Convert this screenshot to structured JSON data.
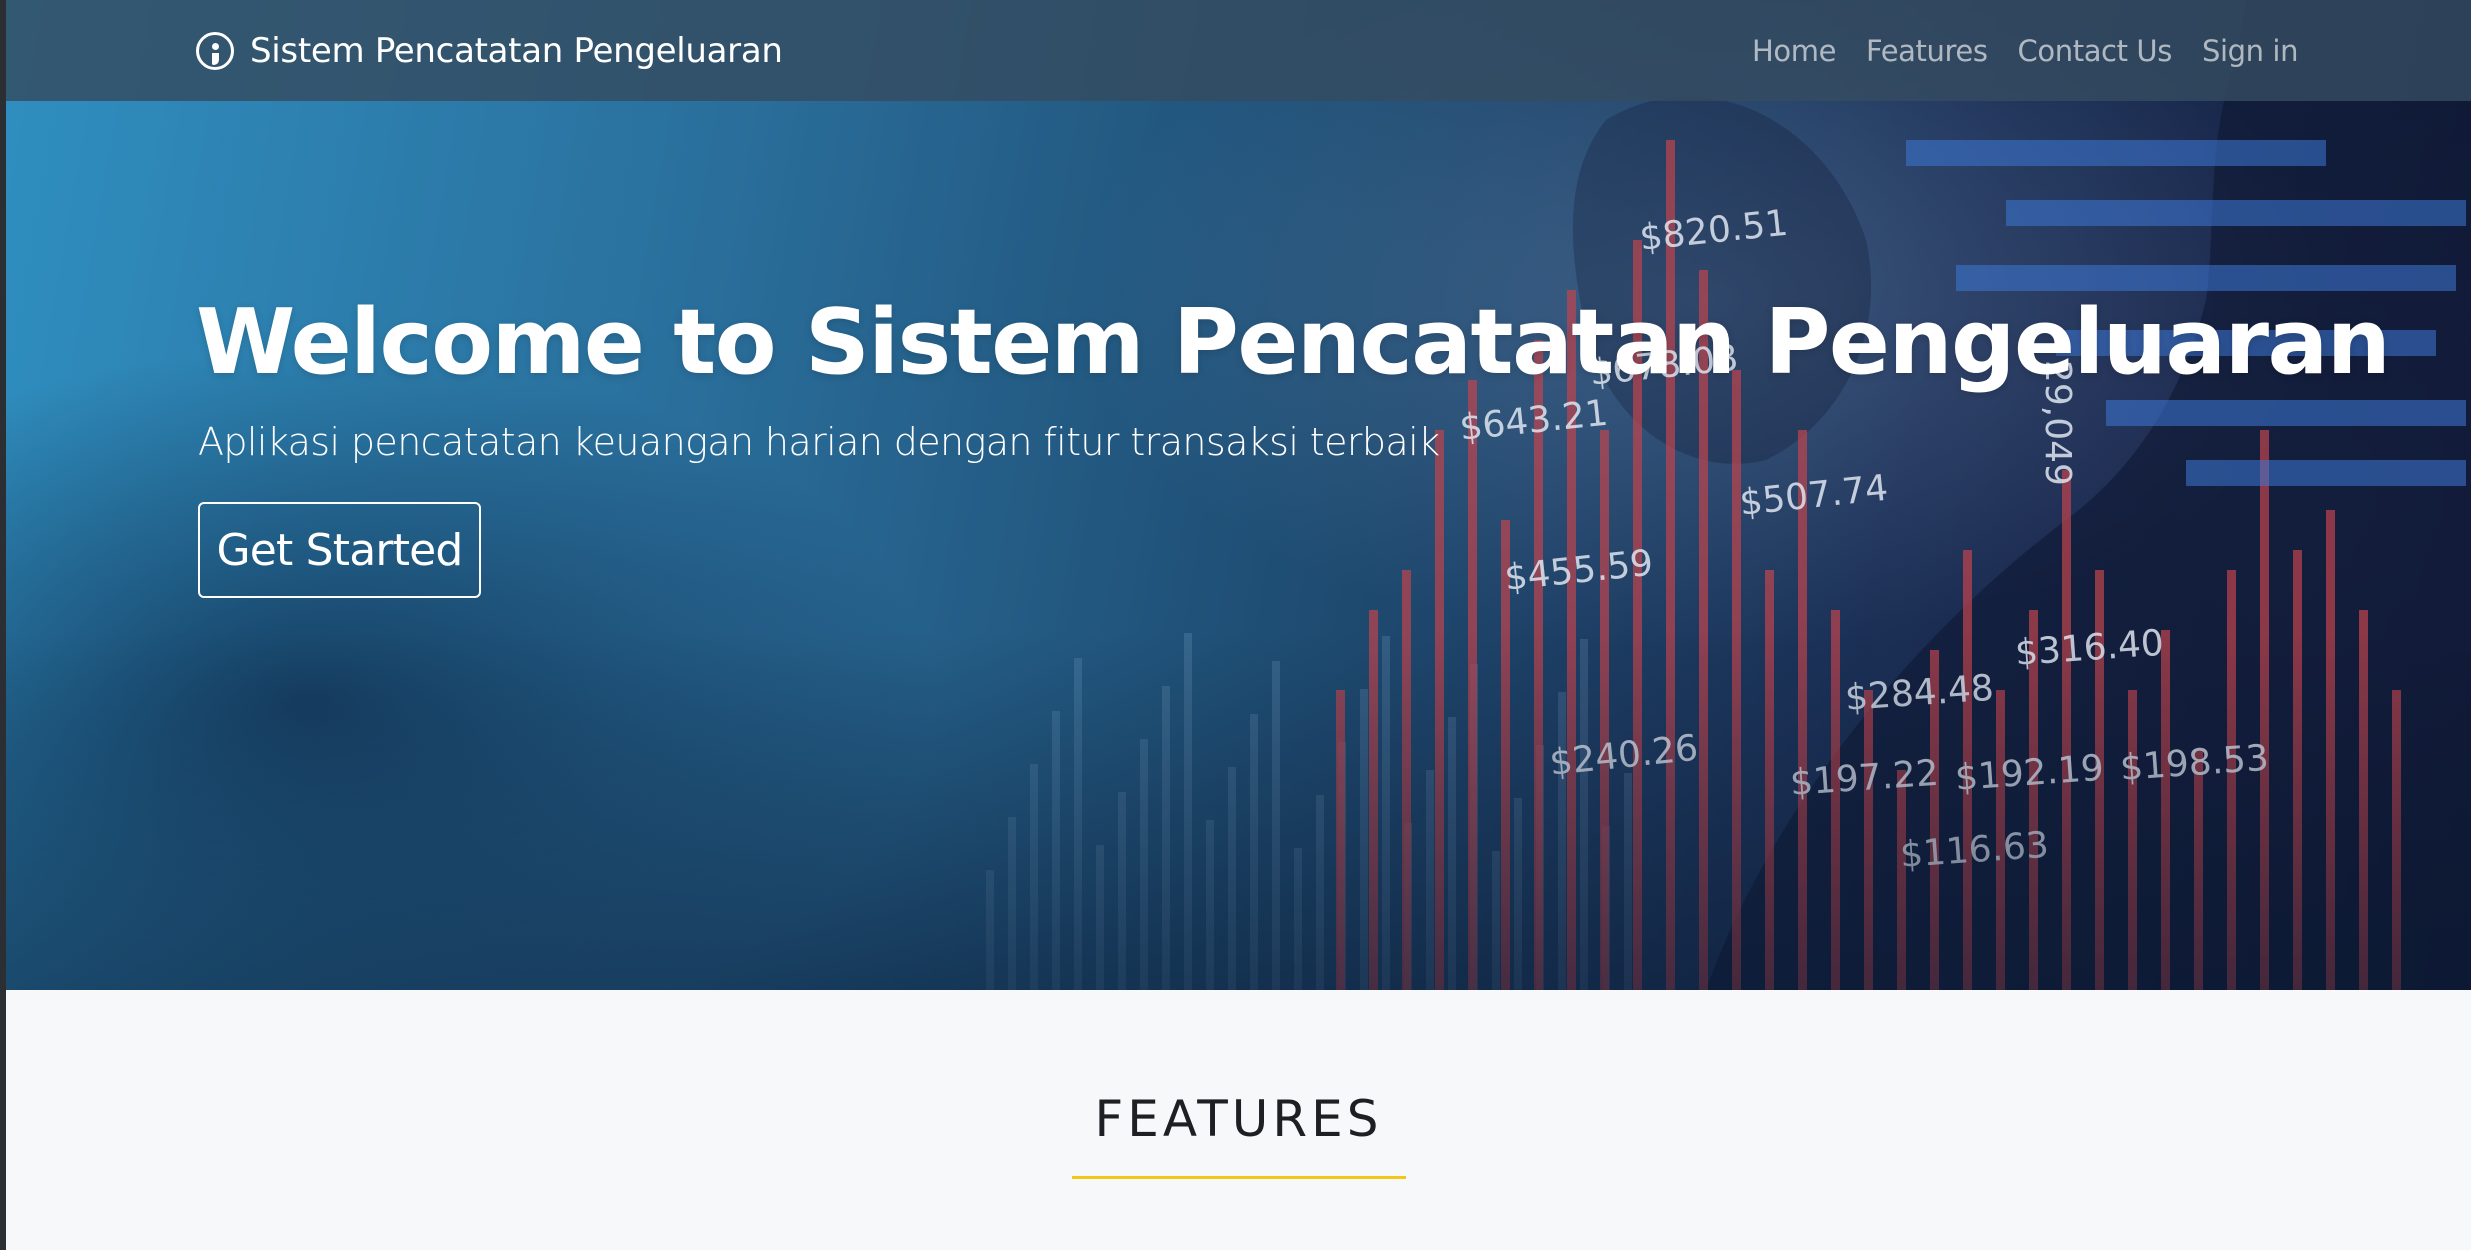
{
  "navbar": {
    "brand": "Sistem Pencatatan Pengeluaran",
    "brand_icon": "semicolon-circle-icon",
    "links": [
      "Home",
      "Features",
      "Contact Us",
      "Sign in"
    ]
  },
  "hero": {
    "title": "Welcome to Sistem Pencatatan Pengeluaran",
    "subtitle": "Aplikasi pencatatan keuangan harian dengan fitur transaksi terbaik",
    "cta_label": "Get Started",
    "background_labels": [
      "$820.51",
      "$678.08",
      "$643.21",
      "$507.74",
      "$455.59",
      "$316.40",
      "$284.48",
      "$240.26",
      "$197.22",
      "$192.19",
      "$198.53",
      "$116.63",
      "29,049"
    ]
  },
  "features": {
    "heading": "FEATURES"
  },
  "colors": {
    "accent_underline": "#f5c518",
    "navbar": "#344c60",
    "hero_left": "#2f8fc0",
    "hero_right": "#141d3c",
    "page_background": "#f7f8fa"
  }
}
